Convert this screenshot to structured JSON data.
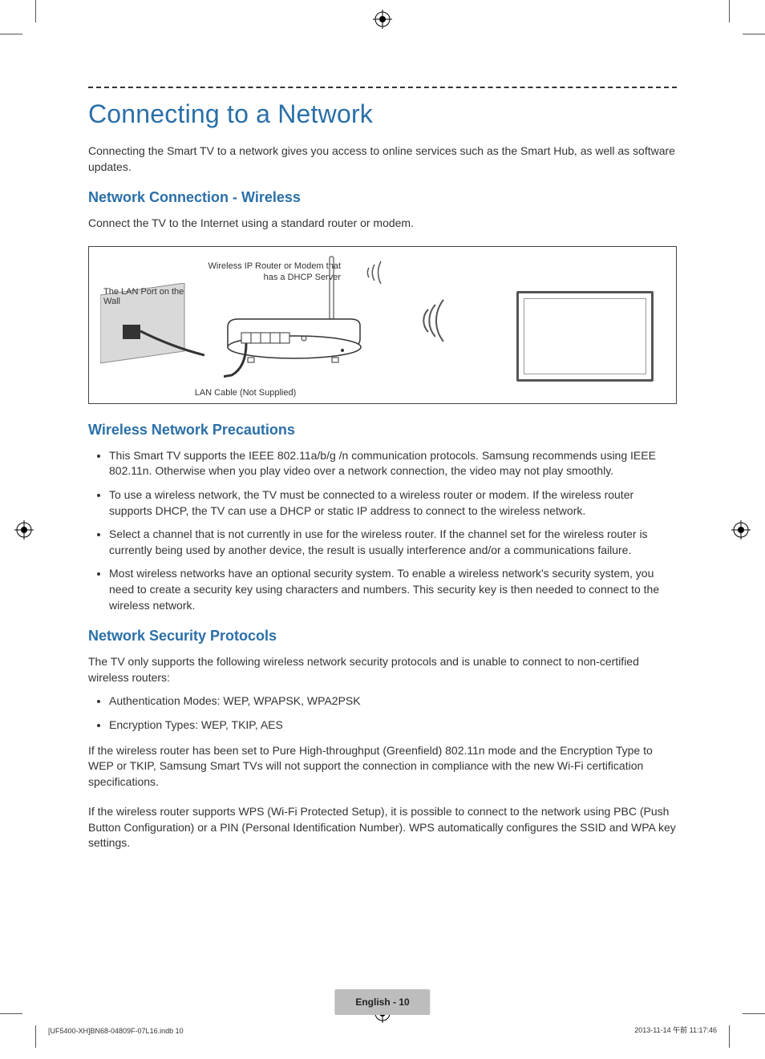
{
  "page_title": "Connecting to a Network",
  "intro": "Connecting the Smart TV to a network gives you access to online services such as the Smart Hub, as well as software updates.",
  "section1": {
    "heading": "Network Connection - Wireless",
    "text": "Connect the TV to the Internet using a standard router or modem."
  },
  "figure": {
    "router_label": "Wireless IP Router or Modem that has a DHCP Server",
    "lan_port_label": "The LAN Port on the Wall",
    "cable_label": "LAN Cable (Not Supplied)"
  },
  "section2": {
    "heading": "Wireless Network Precautions",
    "bullets": [
      "This Smart TV supports the IEEE 802.11a/b/g /n communication protocols. Samsung recommends using IEEE 802.11n. Otherwise when you play video over a network connection, the video may not play smoothly.",
      "To use a wireless network, the TV must be connected to a wireless router or modem. If the wireless router supports DHCP, the TV can use a DHCP or static IP address to connect to the wireless network.",
      "Select a channel that is not currently in use for the wireless router. If the channel set for the wireless router is currently being used by another device, the result is usually interference and/or a communications failure.",
      "Most wireless networks have an optional security system. To enable a wireless network's security system, you need to create a security key using characters and numbers. This security key is then needed to connect to the wireless network."
    ]
  },
  "section3": {
    "heading": "Network Security Protocols",
    "intro": "The TV only supports the following wireless network security protocols and is unable to connect to non-certified wireless routers:",
    "bullets": [
      "Authentication Modes: WEP, WPAPSK, WPA2PSK",
      "Encryption Types: WEP, TKIP, AES"
    ],
    "para2": "If the wireless router has been set to Pure High-throughput (Greenfield) 802.11n mode and the Encryption Type to WEP or TKIP, Samsung Smart TVs will not support the connection in compliance with the new Wi-Fi certification specifications.",
    "para3": "If the wireless router supports WPS (Wi-Fi Protected Setup), it is possible to connect to the network using PBC (Push Button Configuration) or a PIN (Personal Identification Number). WPS automatically configures the SSID and WPA key settings."
  },
  "footer": {
    "pill": "English - 10",
    "left": "[UF5400-XH]BN68-04809F-07L16.indb   10",
    "right": "2013-11-14   午前 11:17:46"
  }
}
